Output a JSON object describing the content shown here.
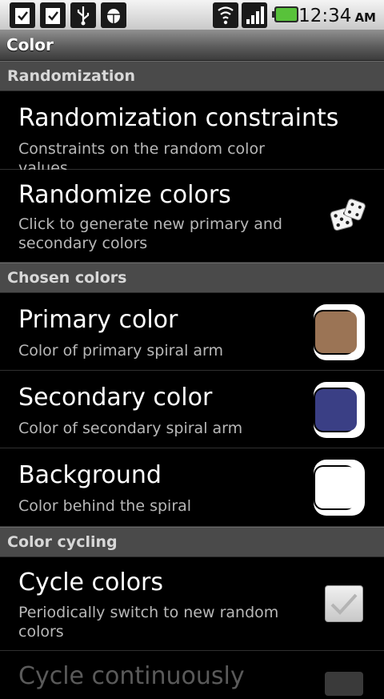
{
  "status_bar": {
    "icons": [
      "clipboard-check-icon",
      "clipboard-check-icon",
      "usb-icon",
      "android-debug-icon",
      "wifi-icon",
      "signal-icon",
      "battery-icon"
    ],
    "time": "12:34",
    "ampm": "AM"
  },
  "title": "Color",
  "categories": {
    "randomization": "Randomization",
    "chosen": "Chosen colors",
    "cycling": "Color cycling"
  },
  "items": {
    "constraints": {
      "title": "Randomization constraints",
      "summary": "Constraints on the random color values"
    },
    "randomize": {
      "title": "Randomize colors",
      "summary": "Click to generate new primary and secondary colors",
      "icon": "dice-icon"
    },
    "primary": {
      "title": "Primary color",
      "summary": "Color of primary spiral arm",
      "color": "#9b7455"
    },
    "secondary": {
      "title": "Secondary color",
      "summary": "Color of secondary spiral arm",
      "color": "#3a3f85"
    },
    "background": {
      "title": "Background",
      "summary": "Color behind the spiral",
      "color": "#ffffff"
    },
    "cycle": {
      "title": "Cycle colors",
      "summary": "Periodically switch to new random colors",
      "checked": true
    },
    "cycle_cont": {
      "title": "Cycle continuously"
    }
  }
}
